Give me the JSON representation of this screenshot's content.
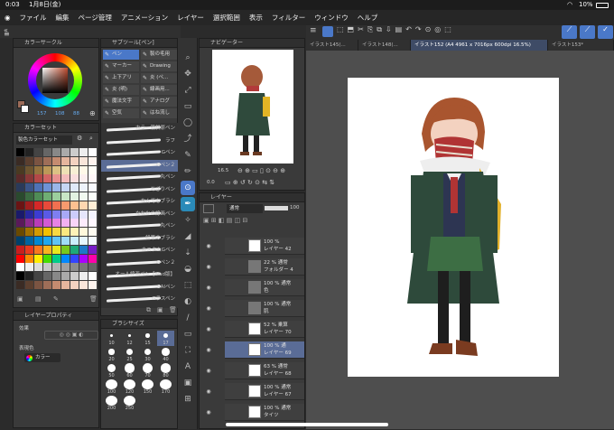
{
  "status": {
    "time": "0:03",
    "date": "1月8日(金)",
    "battery": "10%"
  },
  "menu": [
    "ファイル",
    "編集",
    "ページ管理",
    "アニメーション",
    "レイヤー",
    "選択範囲",
    "表示",
    "フィルター",
    "ウィンドウ",
    "ヘルプ"
  ],
  "doc_tabs": [
    "イラスト145(...",
    "イラスト148(...",
    "イラスト152 (A4 4961 x 7016px 600dpi 16.5%)",
    "イラスト153*"
  ],
  "color_circle": {
    "title": "カラーサークル",
    "values": [
      "157",
      "108",
      "88"
    ]
  },
  "color_set": {
    "title": "カラーセット",
    "select": "製色カラーセット"
  },
  "layer_property": {
    "title": "レイヤープロパティ",
    "effect_label": "効果",
    "expression_label": "表現色",
    "expression_value": "カラー"
  },
  "sub_tool": {
    "title": "サブツール[ペン]",
    "tools": [
      [
        "ペン",
        "製の毛用"
      ],
      [
        "マーカー",
        "Drawing"
      ],
      [
        "上下アリ",
        "炎 (ペ..."
      ],
      [
        "炎 (明)",
        "線画用..."
      ],
      [
        "魔法文字",
        "アナログ"
      ],
      [
        "空気",
        "はね流し"
      ]
    ],
    "brushes": [
      "カラー筋斜原ペン",
      "ラフ",
      "Gペン",
      "Gペン２",
      "丸ペン",
      "あざりペン",
      "なんでもブラシ",
      "ななかの線画ペン",
      "丸ペン",
      "鉛筆のブラシ",
      "カスタムGペン",
      "Gペン２",
      "オール線画ペン【iPad版】",
      "SAIペン",
      "Gラスペン"
    ]
  },
  "brush_size": {
    "title": "ブラシサイズ",
    "sizes": [
      "10",
      "12",
      "15",
      "17",
      "20",
      "25",
      "30",
      "40",
      "50",
      "60",
      "70",
      "80",
      "100",
      "120",
      "150",
      "170",
      "200",
      "250"
    ]
  },
  "navigator": {
    "title": "ナビゲーター",
    "zoom": "16.5",
    "rotate": "0.0"
  },
  "layer_panel": {
    "title": "レイヤー",
    "blend": "通常",
    "opacity": "100",
    "layers": [
      {
        "t1": "100 %",
        "t2": "レイヤー 42"
      },
      {
        "t1": "22 % 通常",
        "t2": "フォルダー 4"
      },
      {
        "t1": "100 % 通常",
        "t2": "色"
      },
      {
        "t1": "100 % 通常",
        "t2": "肌"
      },
      {
        "t1": "52 % 乗算",
        "t2": "レイヤー 70"
      },
      {
        "t1": "100 % 通",
        "t2": "レイヤー 69"
      },
      {
        "t1": "63 % 通常",
        "t2": "レイヤー 68"
      },
      {
        "t1": "100 % 通常",
        "t2": "レイヤー 67"
      },
      {
        "t1": "100 % 通常",
        "t2": "タイツ"
      }
    ]
  },
  "colors": {
    "bg": "#2b2b2b",
    "panel": "#3a3a3a",
    "accent": "#4a78c8",
    "selected_layer": "#5a6c96"
  }
}
